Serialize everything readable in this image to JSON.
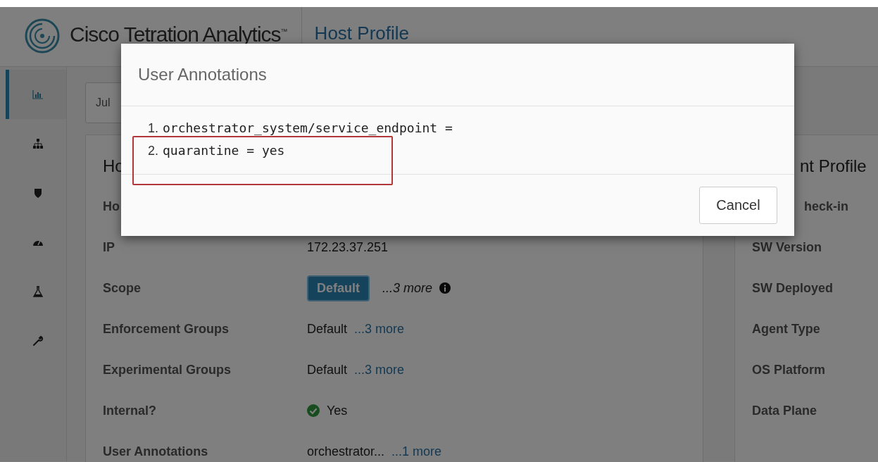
{
  "header": {
    "product": "Cisco Tetration Analytics",
    "trademark": "™",
    "page_title": "Host Profile"
  },
  "sidebar": {
    "items": [
      {
        "selected": true
      },
      {
        "selected": false
      },
      {
        "selected": false
      },
      {
        "selected": false
      },
      {
        "selected": false
      },
      {
        "selected": false
      }
    ]
  },
  "date_field": {
    "value": "Jul"
  },
  "host_card": {
    "title": "Ho",
    "rows": [
      {
        "label": "Ho",
        "kind": "empty"
      },
      {
        "label": "IP",
        "kind": "text",
        "value": "172.23.37.251"
      },
      {
        "label": "Scope",
        "kind": "tag",
        "value": "Default",
        "more": "...3 more",
        "more_is_link": false
      },
      {
        "label": "Enforcement Groups",
        "kind": "text",
        "value": "Default",
        "more": "...3 more",
        "more_is_link": true
      },
      {
        "label": "Experimental Groups",
        "kind": "text",
        "value": "Default",
        "more": "...3 more",
        "more_is_link": true
      },
      {
        "label": "Internal?",
        "kind": "status",
        "value": "Yes"
      },
      {
        "label": "User Annotations",
        "kind": "text",
        "value": "orchestrator...",
        "more": "...1 more",
        "more_is_link": true
      }
    ]
  },
  "agent_card": {
    "title": "nt Profile",
    "rows": [
      "heck-in",
      "SW Version",
      "SW Deployed",
      "Agent Type",
      "OS Platform",
      "Data Plane"
    ]
  },
  "dialog": {
    "title": "User Annotations",
    "annotations": [
      {
        "number": "1.",
        "text": "orchestrator_system/service_endpoint =",
        "highlighted": false
      },
      {
        "number": "2.",
        "text": "quarantine = yes",
        "highlighted": true
      }
    ],
    "buttons": [
      "Cancel"
    ]
  }
}
